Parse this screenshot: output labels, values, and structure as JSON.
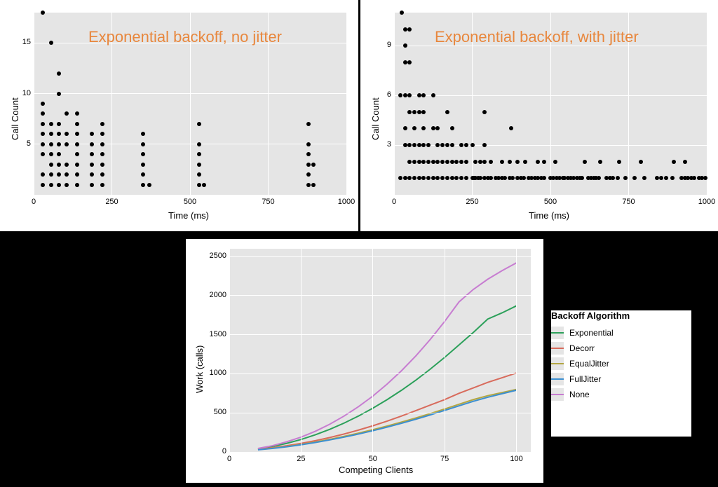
{
  "panel_left": {
    "annotation": "Exponential backoff, no jitter",
    "xlabel": "Time (ms)",
    "ylabel": "Call Count",
    "xticks": [
      "0",
      "250",
      "500",
      "750",
      "1000"
    ],
    "yticks": [
      "5",
      "10",
      "15"
    ]
  },
  "panel_right": {
    "annotation": "Exponential backoff, with jitter",
    "xlabel": "Time (ms)",
    "ylabel": "Call Count",
    "xticks": [
      "0",
      "250",
      "500",
      "750",
      "1000"
    ],
    "yticks": [
      "3",
      "6",
      "9"
    ]
  },
  "panel_bottom": {
    "xlabel": "Competing Clients",
    "ylabel": "Work (calls)",
    "xticks": [
      "0",
      "25",
      "50",
      "75",
      "100"
    ],
    "yticks": [
      "0",
      "500",
      "1000",
      "1500",
      "2000",
      "2500"
    ],
    "legend_title": "Backoff Algorithm",
    "legend": [
      "Exponential",
      "Decorr",
      "EqualJitter",
      "FullJitter",
      "None"
    ]
  },
  "chart_data": [
    {
      "type": "scatter",
      "title": "Exponential backoff, no jitter",
      "xlabel": "Time (ms)",
      "ylabel": "Call Count",
      "xlim": [
        0,
        1000
      ],
      "ylim": [
        0,
        18
      ],
      "points": [
        [
          30,
          1
        ],
        [
          30,
          2
        ],
        [
          30,
          4
        ],
        [
          30,
          5
        ],
        [
          30,
          6
        ],
        [
          30,
          7
        ],
        [
          30,
          8
        ],
        [
          30,
          9
        ],
        [
          30,
          18
        ],
        [
          55,
          1
        ],
        [
          55,
          2
        ],
        [
          55,
          3
        ],
        [
          55,
          4
        ],
        [
          55,
          5
        ],
        [
          55,
          6
        ],
        [
          55,
          7
        ],
        [
          55,
          15
        ],
        [
          80,
          1
        ],
        [
          80,
          2
        ],
        [
          80,
          3
        ],
        [
          80,
          4
        ],
        [
          80,
          5
        ],
        [
          80,
          6
        ],
        [
          80,
          7
        ],
        [
          80,
          10
        ],
        [
          80,
          12
        ],
        [
          105,
          1
        ],
        [
          105,
          2
        ],
        [
          105,
          3
        ],
        [
          105,
          5
        ],
        [
          105,
          6
        ],
        [
          105,
          8
        ],
        [
          140,
          1
        ],
        [
          140,
          2
        ],
        [
          140,
          3
        ],
        [
          140,
          4
        ],
        [
          140,
          5
        ],
        [
          140,
          6
        ],
        [
          140,
          7
        ],
        [
          140,
          8
        ],
        [
          185,
          1
        ],
        [
          185,
          2
        ],
        [
          185,
          3
        ],
        [
          185,
          4
        ],
        [
          185,
          5
        ],
        [
          185,
          6
        ],
        [
          220,
          1
        ],
        [
          220,
          2
        ],
        [
          220,
          3
        ],
        [
          220,
          4
        ],
        [
          220,
          5
        ],
        [
          220,
          6
        ],
        [
          220,
          7
        ],
        [
          350,
          1
        ],
        [
          350,
          2
        ],
        [
          350,
          3
        ],
        [
          350,
          4
        ],
        [
          350,
          5
        ],
        [
          350,
          6
        ],
        [
          370,
          1
        ],
        [
          530,
          1
        ],
        [
          530,
          2
        ],
        [
          530,
          3
        ],
        [
          530,
          4
        ],
        [
          530,
          5
        ],
        [
          530,
          7
        ],
        [
          545,
          1
        ],
        [
          880,
          1
        ],
        [
          880,
          2
        ],
        [
          880,
          3
        ],
        [
          880,
          4
        ],
        [
          880,
          5
        ],
        [
          880,
          7
        ],
        [
          895,
          1
        ],
        [
          895,
          3
        ]
      ]
    },
    {
      "type": "scatter",
      "title": "Exponential backoff, with jitter",
      "xlabel": "Time (ms)",
      "ylabel": "Call Count",
      "xlim": [
        0,
        1000
      ],
      "ylim": [
        0,
        11
      ],
      "points": [
        [
          20,
          1
        ],
        [
          20,
          6
        ],
        [
          25,
          11
        ],
        [
          35,
          1
        ],
        [
          35,
          3
        ],
        [
          35,
          4
        ],
        [
          35,
          6
        ],
        [
          35,
          8
        ],
        [
          35,
          9
        ],
        [
          35,
          10
        ],
        [
          50,
          1
        ],
        [
          50,
          2
        ],
        [
          50,
          3
        ],
        [
          50,
          5
        ],
        [
          50,
          6
        ],
        [
          50,
          8
        ],
        [
          50,
          10
        ],
        [
          65,
          1
        ],
        [
          65,
          2
        ],
        [
          65,
          3
        ],
        [
          65,
          4
        ],
        [
          65,
          5
        ],
        [
          80,
          1
        ],
        [
          80,
          2
        ],
        [
          80,
          3
        ],
        [
          80,
          5
        ],
        [
          80,
          6
        ],
        [
          95,
          1
        ],
        [
          95,
          2
        ],
        [
          95,
          3
        ],
        [
          95,
          4
        ],
        [
          95,
          5
        ],
        [
          95,
          6
        ],
        [
          110,
          1
        ],
        [
          110,
          2
        ],
        [
          110,
          3
        ],
        [
          125,
          1
        ],
        [
          125,
          2
        ],
        [
          125,
          4
        ],
        [
          125,
          6
        ],
        [
          140,
          1
        ],
        [
          140,
          2
        ],
        [
          140,
          3
        ],
        [
          140,
          4
        ],
        [
          155,
          1
        ],
        [
          155,
          2
        ],
        [
          155,
          3
        ],
        [
          170,
          1
        ],
        [
          170,
          2
        ],
        [
          170,
          3
        ],
        [
          170,
          5
        ],
        [
          185,
          1
        ],
        [
          185,
          2
        ],
        [
          185,
          3
        ],
        [
          185,
          4
        ],
        [
          200,
          1
        ],
        [
          200,
          2
        ],
        [
          215,
          1
        ],
        [
          215,
          2
        ],
        [
          215,
          3
        ],
        [
          230,
          1
        ],
        [
          230,
          2
        ],
        [
          230,
          3
        ],
        [
          250,
          1
        ],
        [
          250,
          3
        ],
        [
          255,
          1
        ],
        [
          260,
          1
        ],
        [
          260,
          2
        ],
        [
          270,
          1
        ],
        [
          275,
          1
        ],
        [
          275,
          2
        ],
        [
          290,
          1
        ],
        [
          290,
          2
        ],
        [
          290,
          3
        ],
        [
          290,
          5
        ],
        [
          300,
          1
        ],
        [
          310,
          1
        ],
        [
          310,
          2
        ],
        [
          325,
          1
        ],
        [
          335,
          1
        ],
        [
          345,
          1
        ],
        [
          345,
          2
        ],
        [
          355,
          1
        ],
        [
          370,
          1
        ],
        [
          370,
          2
        ],
        [
          375,
          4
        ],
        [
          380,
          1
        ],
        [
          395,
          1
        ],
        [
          395,
          2
        ],
        [
          405,
          1
        ],
        [
          415,
          1
        ],
        [
          420,
          2
        ],
        [
          430,
          1
        ],
        [
          440,
          1
        ],
        [
          450,
          1
        ],
        [
          460,
          1
        ],
        [
          460,
          2
        ],
        [
          470,
          1
        ],
        [
          480,
          1
        ],
        [
          480,
          2
        ],
        [
          500,
          1
        ],
        [
          510,
          1
        ],
        [
          515,
          2
        ],
        [
          520,
          1
        ],
        [
          530,
          1
        ],
        [
          540,
          1
        ],
        [
          545,
          1
        ],
        [
          555,
          1
        ],
        [
          565,
          1
        ],
        [
          575,
          1
        ],
        [
          585,
          1
        ],
        [
          595,
          1
        ],
        [
          600,
          1
        ],
        [
          610,
          2
        ],
        [
          620,
          1
        ],
        [
          630,
          1
        ],
        [
          640,
          1
        ],
        [
          645,
          1
        ],
        [
          655,
          1
        ],
        [
          660,
          2
        ],
        [
          680,
          1
        ],
        [
          690,
          1
        ],
        [
          700,
          1
        ],
        [
          715,
          1
        ],
        [
          720,
          2
        ],
        [
          740,
          1
        ],
        [
          770,
          1
        ],
        [
          790,
          2
        ],
        [
          800,
          1
        ],
        [
          840,
          1
        ],
        [
          855,
          1
        ],
        [
          870,
          1
        ],
        [
          890,
          1
        ],
        [
          895,
          2
        ],
        [
          920,
          1
        ],
        [
          930,
          1
        ],
        [
          930,
          2
        ],
        [
          940,
          1
        ],
        [
          950,
          1
        ],
        [
          960,
          1
        ],
        [
          975,
          1
        ],
        [
          985,
          1
        ],
        [
          995,
          1
        ]
      ]
    },
    {
      "type": "line",
      "title": "Work vs competing clients",
      "xlabel": "Competing Clients",
      "ylabel": "Work (calls)",
      "xlim": [
        0,
        105
      ],
      "ylim": [
        0,
        2600
      ],
      "x": [
        10,
        15,
        20,
        25,
        30,
        35,
        40,
        45,
        50,
        55,
        60,
        65,
        70,
        75,
        80,
        85,
        90,
        95,
        100
      ],
      "series": [
        {
          "name": "Exponential",
          "color": "#2ca05a",
          "values": [
            40,
            70,
            110,
            160,
            220,
            290,
            370,
            460,
            560,
            670,
            790,
            920,
            1060,
            1210,
            1370,
            1530,
            1700,
            1780,
            1870
          ]
        },
        {
          "name": "Decorr",
          "color": "#d86b5c",
          "values": [
            35,
            55,
            80,
            110,
            145,
            185,
            230,
            280,
            335,
            395,
            460,
            530,
            600,
            670,
            750,
            820,
            890,
            950,
            1010
          ]
        },
        {
          "name": "EqualJitter",
          "color": "#b3a642",
          "values": [
            30,
            48,
            70,
            97,
            128,
            162,
            200,
            241,
            285,
            332,
            382,
            435,
            491,
            550,
            610,
            670,
            720,
            760,
            800
          ]
        },
        {
          "name": "FullJitter",
          "color": "#3c8fd1",
          "values": [
            28,
            45,
            66,
            92,
            121,
            154,
            190,
            229,
            272,
            318,
            367,
            419,
            474,
            532,
            590,
            648,
            700,
            745,
            790
          ]
        },
        {
          "name": "None",
          "color": "#c77dd1",
          "values": [
            45,
            80,
            130,
            190,
            265,
            355,
            460,
            580,
            715,
            870,
            1040,
            1230,
            1440,
            1670,
            1920,
            2080,
            2210,
            2320,
            2420
          ]
        }
      ],
      "legend_title": "Backoff Algorithm"
    }
  ]
}
